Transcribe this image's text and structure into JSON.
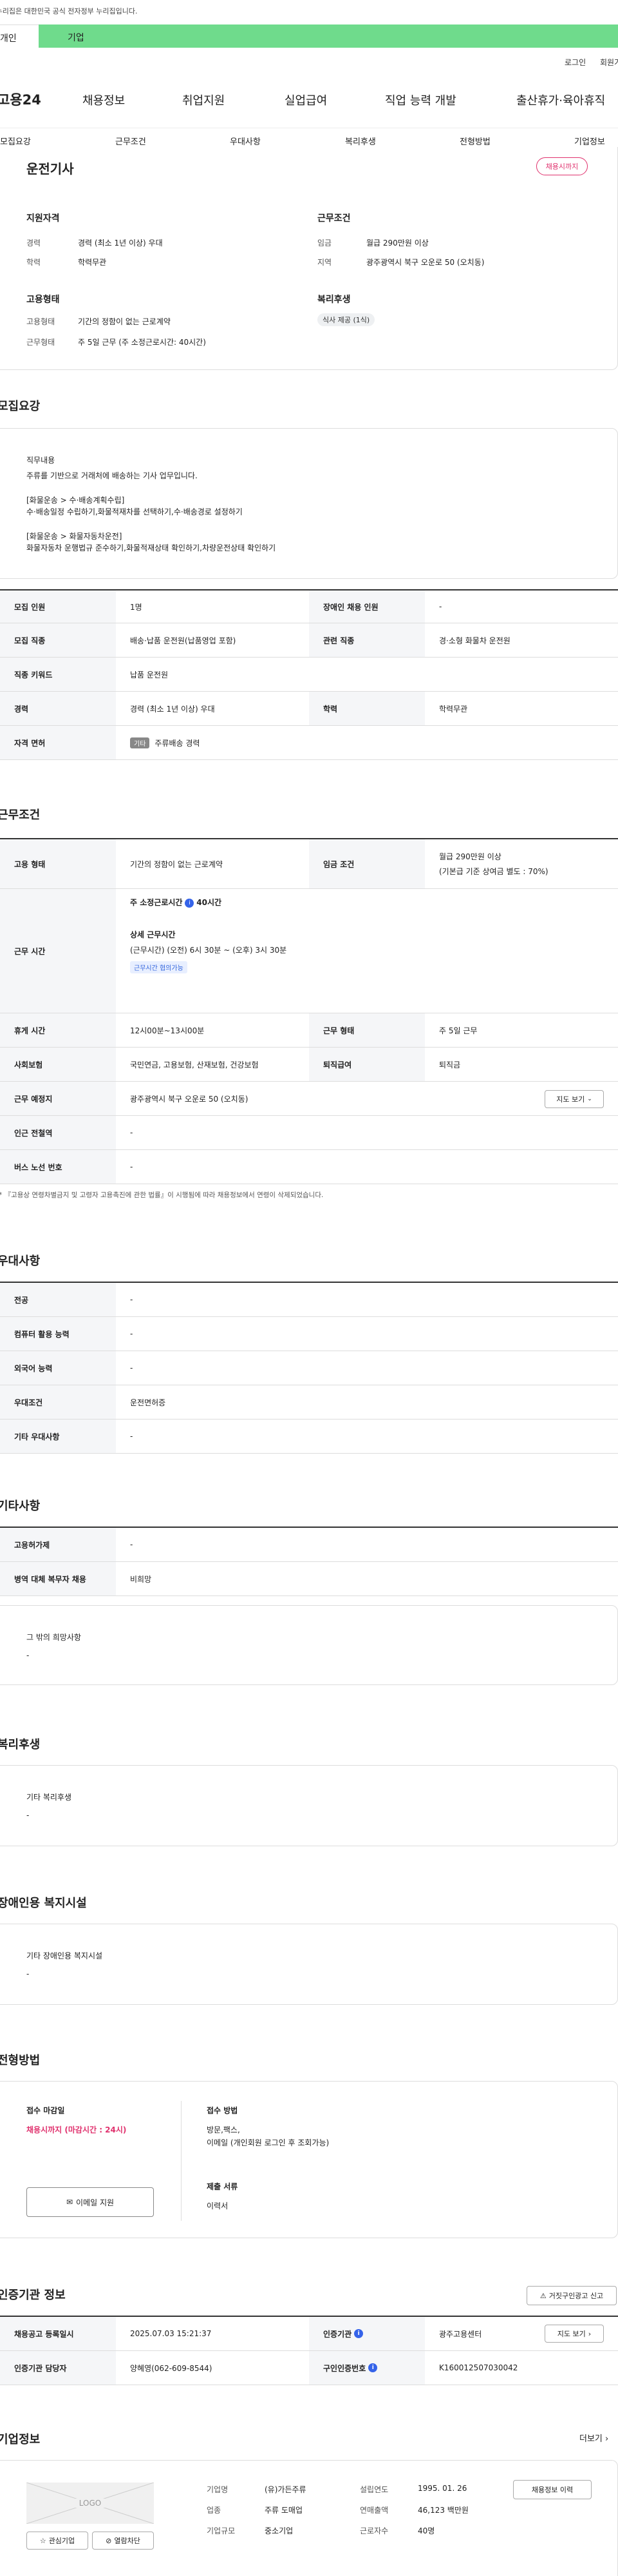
{
  "gov_notice": "이 누리집은 대한민국 공식 전자정부 누리집입니다.",
  "top_tabs": [
    "개인",
    "기업"
  ],
  "util_links": [
    "로그인",
    "회원가입"
  ],
  "logo": "고용24",
  "gnb": [
    "채용정보",
    "취업지원",
    "실업급여",
    "직업 능력 개발",
    "출산휴가·육아휴직"
  ],
  "subnav": [
    "모집요강",
    "근무조건",
    "우대사항",
    "복리후생",
    "전형방법",
    "기업정보"
  ],
  "summary": {
    "title": "운전기사",
    "status_badge": "채용시까지",
    "qual_heading": "지원자격",
    "career_label": "경력",
    "career_value": "경력 (최소 1년 이상) 우대",
    "edu_label": "학력",
    "edu_value": "학력무관",
    "work_heading": "근무조건",
    "wage_label": "임금",
    "wage_value": "월급 290만원 이상",
    "region_label": "지역",
    "region_value": "광주광역시 북구 오운로 50 (오치동)",
    "emp_heading": "고용형태",
    "emp_type_label": "고용형태",
    "emp_type_value": "기간의 정함이 없는 근로계약",
    "work_form_label": "근무형태",
    "work_form_value": "주 5일 근무 (주 소정근로시간: 40시간)",
    "welfare_heading": "복리후생",
    "welfare_chip": "식사 제공 (1식)"
  },
  "recruit": {
    "heading": "모집요강",
    "duty_title": "직무내용",
    "duty_lines": [
      "주류를 기반으로 거래처에 배송하는 기사 업무입니다.",
      "[화물운송 > 수·배송계획수립]",
      "수·배송일정 수립하기,화물적재차를 선택하기,수·배송경로 설정하기",
      "[화물운송 > 화물자동차운전]",
      "화물자동차 운행법규 준수하기,화물적재상태 확인하기,차량운전상태 확인하기"
    ],
    "rows": [
      {
        "l1": "모집 인원",
        "v1": "1명",
        "l2": "장애인 채용 인원",
        "v2": "-"
      },
      {
        "l1": "모집 직종",
        "v1": "배송·납품 운전원(납품영업 포함)",
        "l2": "관련 직종",
        "v2": "경·소형 화물차 운전원"
      },
      {
        "l1": "직종 키워드",
        "v1": "납품 운전원"
      },
      {
        "l1": "경력",
        "v1": "경력 (최소 1년 이상) 우대",
        "l2": "학력",
        "v2": "학력무관"
      },
      {
        "l1": "자격 면허",
        "v1_tag": "기타",
        "v1": "주류배송 경력"
      }
    ]
  },
  "conditions": {
    "heading": "근무조건",
    "emp_type_label": "고용 형태",
    "emp_type_value": "기간의 정함이 없는 근로계약",
    "wage_label": "임금 조건",
    "wage_value": "월급 290만원 이상",
    "wage_note": "(기본급 기준 상여금 별도 : 70%)",
    "hours_label": "근무 시간",
    "weekly_hours_label": "주 소정근로시간",
    "weekly_hours_value": "40시간",
    "detail_label": "상세 근무시간",
    "detail_value": "(근무시간) (오전) 6시 30분 ~ (오후) 3시 30분",
    "consult_tag": "근무시간 협의가능",
    "break_label": "휴게 시간",
    "break_value": "12시00분~13시00분",
    "form_label": "근무 형태",
    "form_value": "주 5일 근무",
    "insurance_label": "사회보험",
    "insurance_value": "국민연금, 고용보험, 산재보험, 건강보험",
    "severance_label": "퇴직급여",
    "severance_value": "퇴직금",
    "place_label": "근무 예정지",
    "place_value": "광주광역시 북구 오운로 50 (오치동)",
    "map_btn": "지도 보기",
    "subway_label": "인근 전철역",
    "subway_value": "-",
    "bus_label": "버스 노선 번호",
    "bus_value": "-",
    "footnote": "* 『고용상 연령차별금지 및 고령자 고용촉진에 관한 법률』이 시행됨에 따라 채용정보에서 연령이 삭제되었습니다."
  },
  "preference": {
    "heading": "우대사항",
    "rows": [
      {
        "l": "전공",
        "v": "-"
      },
      {
        "l": "컴퓨터 활용 능력",
        "v": "-"
      },
      {
        "l": "외국어 능력",
        "v": "-"
      },
      {
        "l": "우대조건",
        "v": "운전면허증"
      },
      {
        "l": "기타 우대사항",
        "v": "-"
      }
    ]
  },
  "others": {
    "heading": "기타사항",
    "rows": [
      {
        "l": "고용허가제",
        "v": "-"
      },
      {
        "l": "병역 대체 복무자 채용",
        "v": "비희망"
      }
    ],
    "wish_title": "그 밖의 희망사항",
    "wish_value": "-"
  },
  "welfare": {
    "heading": "복리후생",
    "title": "기타 복리후생",
    "value": "-"
  },
  "disabled": {
    "heading": "장애인용 복지시설",
    "title": "기타 장애인용 복지시설",
    "value": "-"
  },
  "process": {
    "heading": "전형방법",
    "deadline_title": "접수 마감일",
    "deadline_value": "채용시까지 (마감시간 : 24시)",
    "method_title": "접수 방법",
    "method_lines": [
      "방문,팩스,",
      "이메일 (개인회원 로그인 후 조회가능)"
    ],
    "docs_title": "제출 서류",
    "docs_value": "이력서",
    "email_btn": "이메일 지원"
  },
  "agency": {
    "heading": "인증기관 정보",
    "report_btn": "거짓구인광고 신고",
    "reg_label": "채용공고 등록일시",
    "reg_value": "2025.07.03 15:21:37",
    "org_label": "인증기관",
    "org_value": "광주고용센터",
    "map_btn": "지도 보기",
    "manager_label": "인증기관 담당자",
    "manager_value": "양혜영(062-609-8544)",
    "ad_no_label": "구인인증번호",
    "ad_no_value": "K160012507030042"
  },
  "company": {
    "heading": "기업정보",
    "more": "더보기",
    "logo_text": "LOGO",
    "interest_btn": "관심기업",
    "block_btn": "열람차단",
    "history_btn": "채용정보 이력",
    "name_label": "기업명",
    "name_value": "(유)가든주류",
    "industry_label": "업종",
    "industry_value": "주류 도매업",
    "size_label": "기업규모",
    "size_value": "중소기업",
    "founded_label": "설립연도",
    "founded_value": "1995. 01. 26",
    "sales_label": "연매출액",
    "sales_value": "46,123 백만원",
    "staff_label": "근로자수",
    "staff_value": "40명"
  }
}
